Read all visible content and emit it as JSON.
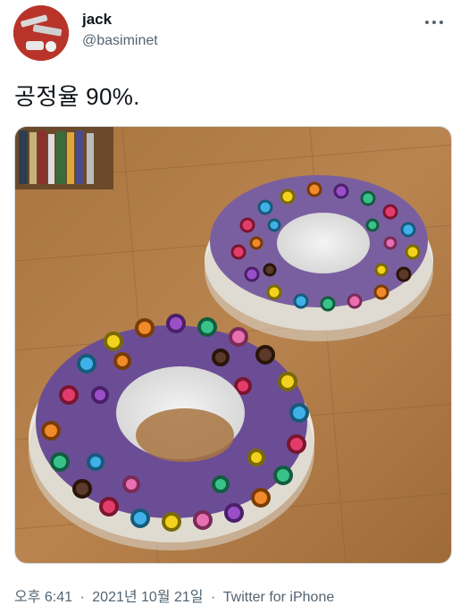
{
  "author": {
    "display_name": "jack",
    "handle": "@basiminet"
  },
  "tweet": {
    "text": "공정율 90%."
  },
  "media": {
    "description_icon": "photo-two-donut-models"
  },
  "meta": {
    "time": "오후 6:41",
    "separator": "·",
    "date": "2021년 10월 21일",
    "source": "Twitter for iPhone"
  },
  "icons": {
    "more": "more-horizontal-icon"
  },
  "colors": {
    "text_primary": "#0f1419",
    "text_secondary": "#536471",
    "avatar_bg": "#c0392b",
    "floor": "#b07a45"
  }
}
